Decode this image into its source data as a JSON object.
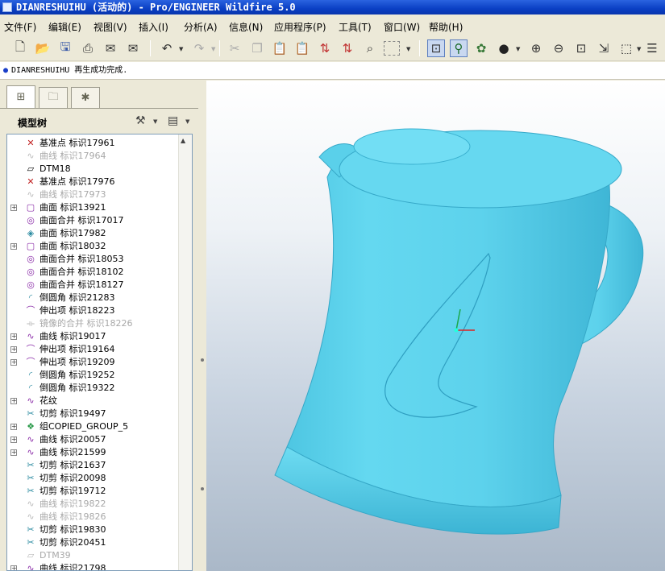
{
  "window": {
    "title": "DIANRESHUIHU (活动的) - Pro/ENGINEER Wildfire 5.0"
  },
  "menu": [
    {
      "label": "文件(F)"
    },
    {
      "label": "编辑(E)"
    },
    {
      "label": "视图(V)"
    },
    {
      "label": "插入(I)"
    },
    {
      "label": "分析(A)"
    },
    {
      "label": "信息(N)"
    },
    {
      "label": "应用程序(P)"
    },
    {
      "label": "工具(T)"
    },
    {
      "label": "窗口(W)"
    },
    {
      "label": "帮助(H)"
    }
  ],
  "toolbar": {
    "icons": [
      "new-file-icon",
      "open-icon",
      "save-icon",
      "print-icon",
      "email-icon",
      "email-attach-icon",
      "undo-icon",
      "redo-icon",
      "cut-icon",
      "copy-icon",
      "paste-icon",
      "paste-special-icon",
      "regenerate-icon",
      "regen-manager-icon",
      "find-icon",
      "select-box-icon",
      "spin-center-icon",
      "datum-display-icon",
      "view-orient-icon",
      "shading-icon",
      "zoom-in-icon",
      "zoom-out-icon",
      "refit-icon",
      "orient-icon",
      "saved-views-icon",
      "layers-icon"
    ]
  },
  "message": {
    "text": "DIANRESHUIHU 再生成功完成."
  },
  "tree": {
    "title": "模型树",
    "items": [
      {
        "label": "基准点 标识17961",
        "icon": "datum-point-icon",
        "expand": false,
        "suppressed": false
      },
      {
        "label": "曲线 标识17964",
        "icon": "curve-icon",
        "expand": false,
        "suppressed": true
      },
      {
        "label": "DTM18",
        "icon": "datum-plane-icon",
        "expand": false,
        "suppressed": false
      },
      {
        "label": "基准点 标识17976",
        "icon": "datum-point-icon",
        "expand": false,
        "suppressed": false
      },
      {
        "label": "曲线 标识17973",
        "icon": "curve-icon",
        "expand": false,
        "suppressed": true
      },
      {
        "label": "曲面 标识13921",
        "icon": "surface-icon",
        "expand": true,
        "suppressed": false
      },
      {
        "label": "曲面合并 标识17017",
        "icon": "merge-icon",
        "expand": false,
        "suppressed": false
      },
      {
        "label": "曲面 标识17982",
        "icon": "surface-sweep-icon",
        "expand": false,
        "suppressed": false
      },
      {
        "label": "曲面 标识18032",
        "icon": "surface-icon",
        "expand": true,
        "suppressed": false
      },
      {
        "label": "曲面合并 标识18053",
        "icon": "merge-icon",
        "expand": false,
        "suppressed": false
      },
      {
        "label": "曲面合并 标识18102",
        "icon": "merge-icon",
        "expand": false,
        "suppressed": false
      },
      {
        "label": "曲面合并 标识18127",
        "icon": "merge-icon",
        "expand": false,
        "suppressed": false
      },
      {
        "label": "倒圆角 标识21283",
        "icon": "round-icon",
        "expand": false,
        "suppressed": false
      },
      {
        "label": "伸出项 标识18223",
        "icon": "protrusion-icon",
        "expand": false,
        "suppressed": false
      },
      {
        "label": "镜像的合并 标识18226",
        "icon": "mirror-icon",
        "expand": false,
        "suppressed": true
      },
      {
        "label": "曲线 标识19017",
        "icon": "curve-icon",
        "expand": true,
        "suppressed": false
      },
      {
        "label": "伸出项 标识19164",
        "icon": "protrusion-icon",
        "expand": true,
        "suppressed": false
      },
      {
        "label": "伸出项 标识19209",
        "icon": "protrusion-icon",
        "expand": true,
        "suppressed": false
      },
      {
        "label": "倒圆角 标识19252",
        "icon": "round-icon",
        "expand": false,
        "suppressed": false
      },
      {
        "label": "倒圆角 标识19322",
        "icon": "round-icon",
        "expand": false,
        "suppressed": false
      },
      {
        "label": "花纹",
        "icon": "curve-icon",
        "expand": true,
        "suppressed": false
      },
      {
        "label": "切剪 标识19497",
        "icon": "cut-feature-icon",
        "expand": false,
        "suppressed": false
      },
      {
        "label": "组COPIED_GROUP_5",
        "icon": "group-icon",
        "expand": true,
        "suppressed": false
      },
      {
        "label": "曲线 标识20057",
        "icon": "curve-icon",
        "expand": true,
        "suppressed": false
      },
      {
        "label": "曲线 标识21599",
        "icon": "curve-icon",
        "expand": true,
        "suppressed": false
      },
      {
        "label": "切剪 标识21637",
        "icon": "cut-feature-icon",
        "expand": false,
        "suppressed": false
      },
      {
        "label": "切剪 标识20098",
        "icon": "cut-feature-icon",
        "expand": false,
        "suppressed": false
      },
      {
        "label": "切剪 标识19712",
        "icon": "cut-feature-icon",
        "expand": false,
        "suppressed": false
      },
      {
        "label": "曲线 标识19822",
        "icon": "curve-icon",
        "expand": false,
        "suppressed": true
      },
      {
        "label": "曲线 标识19826",
        "icon": "curve-icon",
        "expand": false,
        "suppressed": true
      },
      {
        "label": "切剪 标识19830",
        "icon": "cut-feature-icon",
        "expand": false,
        "suppressed": false
      },
      {
        "label": "切剪 标识20451",
        "icon": "cut-feature-icon",
        "expand": false,
        "suppressed": false
      },
      {
        "label": "DTM39",
        "icon": "datum-plane-icon",
        "expand": false,
        "suppressed": true
      },
      {
        "label": "曲线 标识21798",
        "icon": "curve-icon",
        "expand": true,
        "suppressed": false
      }
    ]
  },
  "colors": {
    "model": "#5fd3ec",
    "model_shade": "#3ab6d4",
    "title_bar": "#0a3fc4",
    "suppressed_text": "#a8a8a8"
  }
}
